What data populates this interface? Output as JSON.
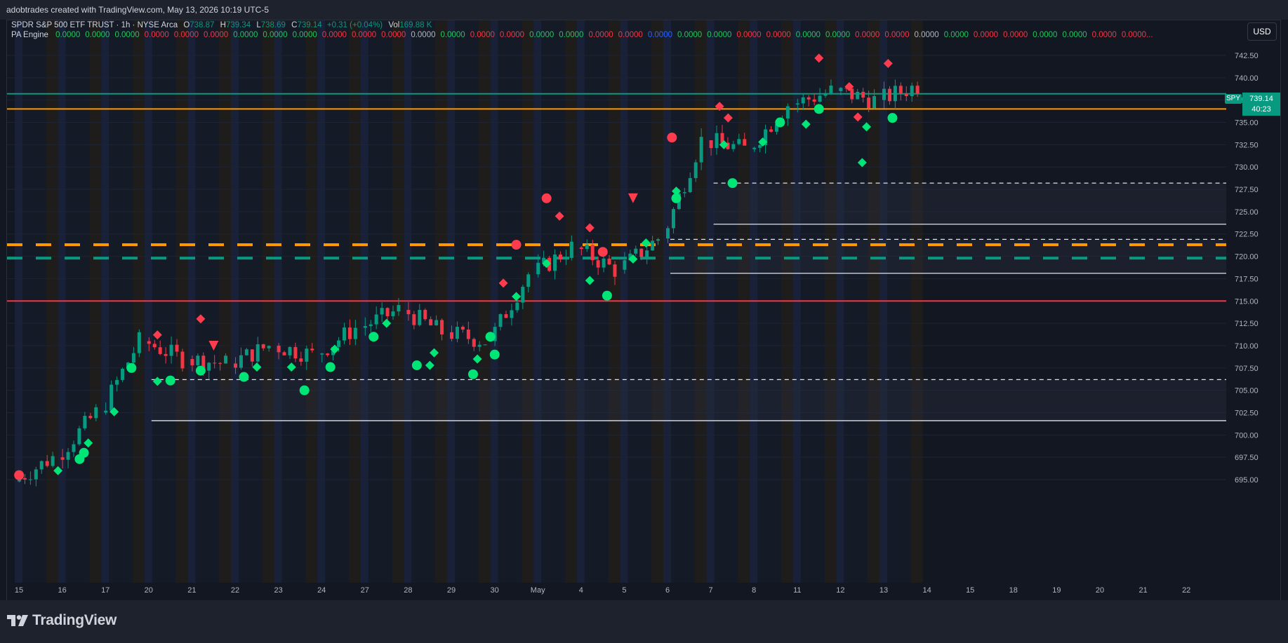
{
  "watermark": "adobtrades created with TradingView.com, May 13, 2026 10:19 UTC-5",
  "currency_button": "USD",
  "symbol_legend": {
    "name": "SPDR S&P 500 ETF TRUST · 1h · NYSE Arca",
    "o_label": "O",
    "o_value": "738.87",
    "h_label": "H",
    "h_value": "739.34",
    "l_label": "L",
    "l_value": "738.69",
    "c_label": "C",
    "c_value": "739.14",
    "change": "+0.31 (+0.04%)",
    "vol_label": "Vol",
    "vol_value": "169.88 K"
  },
  "indicator_legend": {
    "name": "PA Engine",
    "values": [
      {
        "text": "0.0000",
        "color": "#22c55e"
      },
      {
        "text": "0.0000",
        "color": "#22c55e"
      },
      {
        "text": "0.0000",
        "color": "#22c55e"
      },
      {
        "text": "0.0000",
        "color": "#f23645"
      },
      {
        "text": "0.0000",
        "color": "#f23645"
      },
      {
        "text": "0.0000",
        "color": "#f23645"
      },
      {
        "text": "0.0000",
        "color": "#22c55e"
      },
      {
        "text": "0.0000",
        "color": "#22c55e"
      },
      {
        "text": "0.0000",
        "color": "#22c55e"
      },
      {
        "text": "0.0000",
        "color": "#f23645"
      },
      {
        "text": "0.0000",
        "color": "#f23645"
      },
      {
        "text": "0.0000",
        "color": "#f23645"
      },
      {
        "text": "0.0000",
        "color": "#b2b5be"
      },
      {
        "text": "0.0000",
        "color": "#22c55e"
      },
      {
        "text": "0.0000",
        "color": "#f23645"
      },
      {
        "text": "0.0000",
        "color": "#f23645"
      },
      {
        "text": "0.0000",
        "color": "#22c55e"
      },
      {
        "text": "0.0000",
        "color": "#22c55e"
      },
      {
        "text": "0.0000",
        "color": "#f23645"
      },
      {
        "text": "0.0000",
        "color": "#f23645"
      },
      {
        "text": "0.0000",
        "color": "#2962ff"
      },
      {
        "text": "0.0000",
        "color": "#22c55e"
      },
      {
        "text": "0.0000",
        "color": "#22c55e"
      },
      {
        "text": "0.0000",
        "color": "#f23645"
      },
      {
        "text": "0.0000",
        "color": "#f23645"
      },
      {
        "text": "0.0000",
        "color": "#22c55e"
      },
      {
        "text": "0.0000",
        "color": "#22c55e"
      },
      {
        "text": "0.0000",
        "color": "#f23645"
      },
      {
        "text": "0.0000",
        "color": "#f23645"
      },
      {
        "text": "0.0000",
        "color": "#b2b5be"
      },
      {
        "text": "0.0000",
        "color": "#22c55e"
      },
      {
        "text": "0.0000",
        "color": "#f23645"
      },
      {
        "text": "0.0000",
        "color": "#f23645"
      },
      {
        "text": "0.0000",
        "color": "#22c55e"
      },
      {
        "text": "0.0000",
        "color": "#22c55e"
      },
      {
        "text": "0.0000",
        "color": "#f23645"
      },
      {
        "text": "0.0000...",
        "color": "#f23645"
      }
    ]
  },
  "last_price": {
    "symbol": "SPY",
    "price": "739.14",
    "countdown": "40:23"
  },
  "brand": "TradingView",
  "colors": {
    "up": "#089981",
    "down": "#f23645",
    "teal_line": "#089981",
    "orange_line": "#ff9800",
    "red_line": "#f23645",
    "white_line": "#d1d4dc",
    "signal_green": "#00e676",
    "signal_red": "#ff3b4e",
    "marker_yellow": "#ffeb3b"
  },
  "chart_data": {
    "type": "candlestick",
    "symbol": "SPY",
    "interval": "1h",
    "ylim": [
      693.0,
      744.0
    ],
    "y_ticks": [
      "742.50",
      "740.00",
      "737.50",
      "735.00",
      "732.50",
      "730.00",
      "727.50",
      "725.00",
      "722.50",
      "720.00",
      "717.50",
      "715.00",
      "712.50",
      "710.00",
      "707.50",
      "705.00",
      "702.50",
      "700.00",
      "697.50",
      "695.00"
    ],
    "x_ticks": [
      "15",
      "16",
      "17",
      "20",
      "21",
      "22",
      "23",
      "24",
      "27",
      "28",
      "29",
      "30",
      "May",
      "4",
      "5",
      "6",
      "7",
      "8",
      "11",
      "12",
      "13",
      "14",
      "15",
      "18",
      "19",
      "20",
      "21",
      "22"
    ],
    "days_with_data": 21,
    "bars_per_day": 7,
    "day_start_close": [
      694.8,
      697.5,
      702.5,
      710.5,
      708.5,
      708.0,
      710.0,
      709.0,
      712.0,
      714.0,
      711.5,
      710.5,
      718.0,
      721.0,
      718.5,
      722.0,
      733.0,
      732.0,
      737.0,
      738.5,
      737.5
    ],
    "day_end_close": [
      697.5,
      702.5,
      710.5,
      708.5,
      708.0,
      710.0,
      709.0,
      712.0,
      714.0,
      711.5,
      710.5,
      718.0,
      721.0,
      718.5,
      722.0,
      733.0,
      732.0,
      737.0,
      738.5,
      737.5,
      739.14
    ],
    "horizontal_levels": [
      {
        "price": 738.2,
        "style": "solid",
        "color": "#089981"
      },
      {
        "price": 736.5,
        "style": "solid",
        "color": "#ff9800"
      },
      {
        "price": 721.3,
        "style": "dashed-thick",
        "color": "#ff9800"
      },
      {
        "price": 719.8,
        "style": "dashed-thick",
        "color": "#089981"
      },
      {
        "price": 715.0,
        "style": "solid",
        "color": "#f23645"
      }
    ],
    "zones": [
      {
        "from_day": 3,
        "top": 706.2,
        "bottom": 701.6
      },
      {
        "from_day": 16,
        "top": 728.2,
        "bottom": 723.6
      },
      {
        "from_day": 15,
        "top": 721.9,
        "bottom": 718.1
      }
    ],
    "signals": [
      {
        "day": 0.1,
        "price": 695.5,
        "kind": "circle-red"
      },
      {
        "day": 1.0,
        "price": 696.0,
        "kind": "diamond-green"
      },
      {
        "day": 1.5,
        "price": 697.3,
        "kind": "circle-green"
      },
      {
        "day": 1.6,
        "price": 698.0,
        "kind": "circle-green"
      },
      {
        "day": 1.7,
        "price": 699.1,
        "kind": "diamond-green"
      },
      {
        "day": 2.3,
        "price": 702.6,
        "kind": "diamond-green"
      },
      {
        "day": 2.7,
        "price": 707.5,
        "kind": "circle-green"
      },
      {
        "day": 3.3,
        "price": 711.2,
        "kind": "diamond-red"
      },
      {
        "day": 3.3,
        "price": 706.0,
        "kind": "diamond-green"
      },
      {
        "day": 3.6,
        "price": 706.1,
        "kind": "circle-green"
      },
      {
        "day": 4.3,
        "price": 713.0,
        "kind": "diamond-red"
      },
      {
        "day": 4.3,
        "price": 707.2,
        "kind": "circle-green"
      },
      {
        "day": 4.6,
        "price": 710.0,
        "kind": "triangle-red"
      },
      {
        "day": 5.3,
        "price": 706.5,
        "kind": "circle-green"
      },
      {
        "day": 5.6,
        "price": 707.6,
        "kind": "diamond-green"
      },
      {
        "day": 6.4,
        "price": 707.6,
        "kind": "diamond-green"
      },
      {
        "day": 6.7,
        "price": 705.0,
        "kind": "circle-green"
      },
      {
        "day": 7.3,
        "price": 707.6,
        "kind": "circle-green"
      },
      {
        "day": 7.4,
        "price": 709.6,
        "kind": "diamond-green"
      },
      {
        "day": 8.3,
        "price": 711.0,
        "kind": "circle-green"
      },
      {
        "day": 8.6,
        "price": 712.5,
        "kind": "diamond-green"
      },
      {
        "day": 9.3,
        "price": 707.8,
        "kind": "circle-green"
      },
      {
        "day": 9.6,
        "price": 707.8,
        "kind": "diamond-green"
      },
      {
        "day": 9.7,
        "price": 709.2,
        "kind": "diamond-green"
      },
      {
        "day": 10.6,
        "price": 706.8,
        "kind": "circle-green"
      },
      {
        "day": 10.7,
        "price": 708.5,
        "kind": "diamond-green"
      },
      {
        "day": 11.0,
        "price": 711.0,
        "kind": "circle-green"
      },
      {
        "day": 11.1,
        "price": 709.0,
        "kind": "circle-green"
      },
      {
        "day": 11.3,
        "price": 717.0,
        "kind": "diamond-red"
      },
      {
        "day": 11.6,
        "price": 721.3,
        "kind": "circle-red"
      },
      {
        "day": 11.6,
        "price": 715.5,
        "kind": "diamond-green"
      },
      {
        "day": 12.3,
        "price": 726.5,
        "kind": "circle-red"
      },
      {
        "day": 12.3,
        "price": 719.2,
        "kind": "diamond-green"
      },
      {
        "day": 12.6,
        "price": 724.5,
        "kind": "diamond-red"
      },
      {
        "day": 13.3,
        "price": 723.2,
        "kind": "diamond-red"
      },
      {
        "day": 13.3,
        "price": 717.3,
        "kind": "diamond-green"
      },
      {
        "day": 13.6,
        "price": 720.5,
        "kind": "circle-red"
      },
      {
        "day": 13.7,
        "price": 715.6,
        "kind": "circle-green"
      },
      {
        "day": 14.3,
        "price": 726.5,
        "kind": "triangle-red"
      },
      {
        "day": 14.3,
        "price": 719.7,
        "kind": "diamond-green"
      },
      {
        "day": 14.6,
        "price": 721.5,
        "kind": "diamond-green"
      },
      {
        "day": 15.2,
        "price": 733.3,
        "kind": "circle-red"
      },
      {
        "day": 15.3,
        "price": 726.5,
        "kind": "circle-green"
      },
      {
        "day": 15.3,
        "price": 727.3,
        "kind": "diamond-green"
      },
      {
        "day": 16.3,
        "price": 736.8,
        "kind": "diamond-red"
      },
      {
        "day": 16.5,
        "price": 735.5,
        "kind": "diamond-red"
      },
      {
        "day": 16.4,
        "price": 732.5,
        "kind": "diamond-green"
      },
      {
        "day": 16.6,
        "price": 728.2,
        "kind": "circle-green"
      },
      {
        "day": 17.3,
        "price": 732.8,
        "kind": "diamond-green"
      },
      {
        "day": 17.7,
        "price": 735.0,
        "kind": "circle-green"
      },
      {
        "day": 18.3,
        "price": 734.8,
        "kind": "diamond-green"
      },
      {
        "day": 18.6,
        "price": 736.5,
        "kind": "circle-green"
      },
      {
        "day": 18.6,
        "price": 742.2,
        "kind": "diamond-red"
      },
      {
        "day": 19.3,
        "price": 739.0,
        "kind": "diamond-red"
      },
      {
        "day": 19.5,
        "price": 735.6,
        "kind": "diamond-red"
      },
      {
        "day": 19.6,
        "price": 730.5,
        "kind": "diamond-green"
      },
      {
        "day": 19.7,
        "price": 734.5,
        "kind": "diamond-green"
      },
      {
        "day": 20.2,
        "price": 741.6,
        "kind": "diamond-red"
      },
      {
        "day": 20.3,
        "price": 735.5,
        "kind": "circle-green"
      }
    ]
  }
}
